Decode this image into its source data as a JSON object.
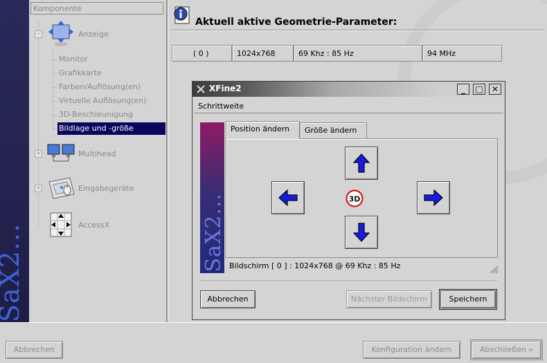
{
  "brand": {
    "text": "SaX2..."
  },
  "tree": {
    "header": "Komponente",
    "groups": [
      {
        "label": "Anzeige",
        "icon": "display-icon",
        "items": [
          {
            "label": "Monitor"
          },
          {
            "label": "Grafikkarte"
          },
          {
            "label": "Farben/Auflösung(en)"
          },
          {
            "label": "Virtuelle Auflösung(en)"
          },
          {
            "label": "3D-Beschleunigung"
          },
          {
            "label": "Bildlage und -größe",
            "selected": true
          }
        ]
      },
      {
        "label": "Multihead",
        "icon": "multihead-icon"
      },
      {
        "label": "Eingabegeräte",
        "icon": "input-devices-icon"
      },
      {
        "label": "AccessX",
        "icon": "accessx-icon"
      }
    ]
  },
  "main": {
    "heading": "Aktuell aktive Geometrie-Parameter:",
    "params": [
      "( 0 )",
      "1024x768",
      "69 Khz : 85 Hz",
      "94 MHz"
    ]
  },
  "dialog": {
    "title": "XFine2",
    "menu": "Schrittweite",
    "banner_text": "SaX2...",
    "tabs": [
      {
        "label": "Position ändern",
        "active": true
      },
      {
        "label": "Größe ändern",
        "active": false
      }
    ],
    "badge": "3D",
    "status": "Bildschirm [ 0 ] : 1024x768 @ 69 Khz : 85 Hz",
    "buttons": {
      "cancel": "Abbrechen",
      "next_screen": "Nächster Bildschirm",
      "save": "Speichern"
    }
  },
  "bottom": {
    "cancel": "Abbrechen",
    "change_config": "Konfiguration ändern",
    "finish": "Abschließen »"
  },
  "colors": {
    "selection": "#07075e",
    "arrow_blue": "#1a1ae6",
    "banner_top": "#8e1a64",
    "banner_bottom": "#1f2a7a"
  }
}
